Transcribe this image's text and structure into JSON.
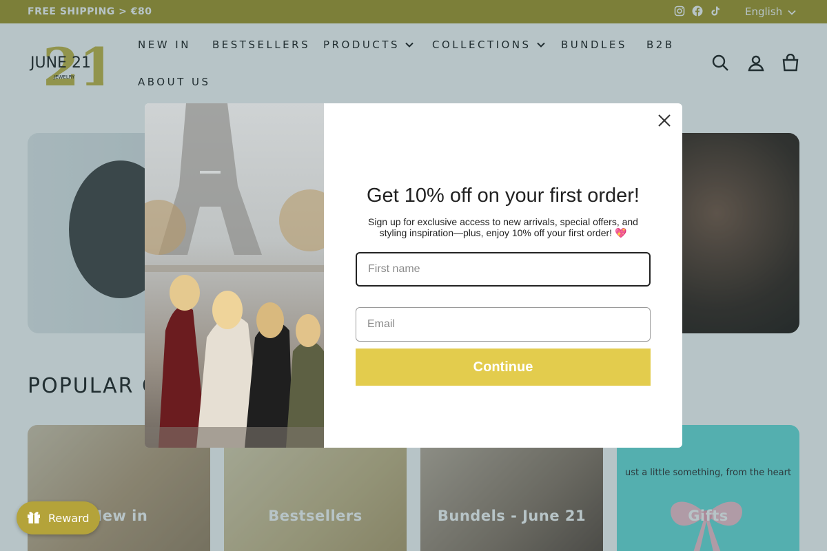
{
  "announcement": {
    "shipping_text": "FREE SHIPPING > €80",
    "language": "English"
  },
  "social_icons": [
    "instagram-icon",
    "facebook-icon",
    "tiktok-icon"
  ],
  "brand": {
    "logo_number": "21",
    "logo_name": "JUNE 21",
    "logo_tag": "JEWELRY"
  },
  "nav": {
    "items": [
      {
        "label": "NEW IN"
      },
      {
        "label": "BESTSELLERS"
      },
      {
        "label": "PRODUCTS",
        "dropdown": true
      },
      {
        "label": "COLLECTIONS",
        "dropdown": true
      },
      {
        "label": "BUNDLES"
      },
      {
        "label": "B2B"
      },
      {
        "label": "ABOUT US"
      }
    ]
  },
  "header_icons": [
    "search-icon",
    "account-icon",
    "cart-icon"
  ],
  "page": {
    "section_title": "POPULAR C"
  },
  "categories": [
    {
      "label": "New in"
    },
    {
      "label": "Bestsellers"
    },
    {
      "label": "Bundels - June 21"
    },
    {
      "label": "Gifts",
      "tagline": "ust a little something, from the heart"
    }
  ],
  "popup": {
    "title": "Get 10% off on your first order!",
    "subtitle": "Sign up for exclusive access to new arrivals, special offers, and styling inspiration—plus, enjoy 10% off your first order! 💖",
    "first_name_placeholder": "First name",
    "email_placeholder": "Email",
    "button": "Continue"
  },
  "reward": {
    "label": "Reward"
  },
  "colors": {
    "accent": "#a89a2f",
    "button": "#e3cc4d",
    "reward": "#b4a33a"
  }
}
